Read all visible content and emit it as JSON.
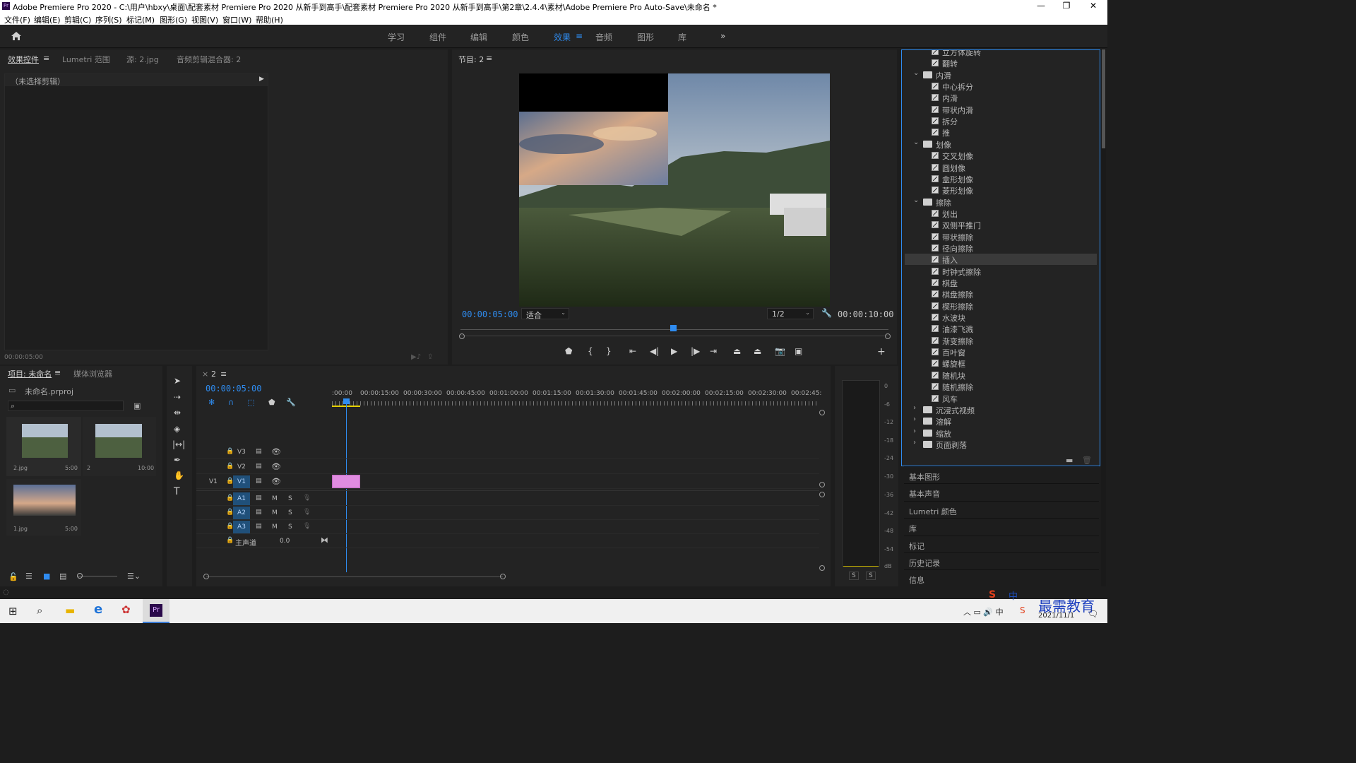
{
  "app": {
    "title": "Adobe Premiere Pro 2020 - C:\\用户\\hbxy\\桌面\\配套素材 Premiere Pro 2020 从新手到高手\\配套素材 Premiere Pro 2020 从新手到高手\\第2章\\2.4.4\\素材\\Adobe Premiere Pro Auto-Save\\未命名 *",
    "logo": "Pr"
  },
  "menu": [
    "文件(F)",
    "编辑(E)",
    "剪辑(C)",
    "序列(S)",
    "标记(M)",
    "图形(G)",
    "视图(V)",
    "窗口(W)",
    "帮助(H)"
  ],
  "workspaces": [
    "学习",
    "组件",
    "编辑",
    "颜色",
    "效果",
    "音频",
    "图形",
    "库"
  ],
  "active_workspace": "效果",
  "source_panel": {
    "tabs": [
      "效果控件",
      "Lumetri 范围",
      "源: 2.jpg",
      "音频剪辑混合器: 2"
    ],
    "no_clip": "（未选择剪辑）",
    "timecode": "00:00:05:00"
  },
  "program": {
    "title": "节目: 2",
    "timecode": "00:00:05:00",
    "fit": "适合",
    "resolution": "1/2",
    "duration": "00:00:10:00"
  },
  "project": {
    "tabs": [
      "项目: 未命名",
      "媒体浏览器"
    ],
    "file": "未命名.prproj",
    "items": [
      {
        "name": "2.jpg",
        "dur": "5:00"
      },
      {
        "name": "2",
        "dur": "10:00"
      },
      {
        "name": "1.jpg",
        "dur": "5:00"
      }
    ]
  },
  "timeline": {
    "tab": "2",
    "timecode": "00:00:05:00",
    "ruler": [
      ":00:00",
      "00:00:15:00",
      "00:00:30:00",
      "00:00:45:00",
      "00:01:00:00",
      "00:01:15:00",
      "00:01:30:00",
      "00:01:45:00",
      "00:02:00:00",
      "00:02:15:00",
      "00:02:30:00",
      "00:02:45:"
    ],
    "video_tracks": [
      "V3",
      "V2",
      "V1"
    ],
    "audio_tracks": [
      "A1",
      "A2",
      "A3"
    ],
    "master": "主声道",
    "master_val": "0.0",
    "source_patch": "V1",
    "track_m": "M",
    "track_s": "S"
  },
  "meter": {
    "labels": [
      "0",
      "-6",
      "-12",
      "-18",
      "-24",
      "-30",
      "-36",
      "-42",
      "-48",
      "-54",
      "dB"
    ],
    "solo": [
      "S",
      "S"
    ]
  },
  "effects_tree": [
    {
      "t": "item",
      "label": "立方体旋转"
    },
    {
      "t": "item",
      "label": "翻转"
    },
    {
      "t": "folder",
      "label": "内滑"
    },
    {
      "t": "item",
      "label": "中心拆分"
    },
    {
      "t": "item",
      "label": "内滑"
    },
    {
      "t": "item",
      "label": "带状内滑"
    },
    {
      "t": "item",
      "label": "拆分"
    },
    {
      "t": "item",
      "label": "推"
    },
    {
      "t": "folder",
      "label": "划像"
    },
    {
      "t": "item",
      "label": "交叉划像"
    },
    {
      "t": "item",
      "label": "圆划像"
    },
    {
      "t": "item",
      "label": "盒形划像"
    },
    {
      "t": "item",
      "label": "菱形划像"
    },
    {
      "t": "folder",
      "label": "擦除"
    },
    {
      "t": "item",
      "label": "划出"
    },
    {
      "t": "item",
      "label": "双侧平推门"
    },
    {
      "t": "item",
      "label": "带状擦除"
    },
    {
      "t": "item",
      "label": "径向擦除"
    },
    {
      "t": "item",
      "label": "插入",
      "selected": true
    },
    {
      "t": "item",
      "label": "时钟式擦除"
    },
    {
      "t": "item",
      "label": "棋盘"
    },
    {
      "t": "item",
      "label": "棋盘擦除"
    },
    {
      "t": "item",
      "label": "楔形擦除"
    },
    {
      "t": "item",
      "label": "水波块"
    },
    {
      "t": "item",
      "label": "油漆飞溅"
    },
    {
      "t": "item",
      "label": "渐变擦除"
    },
    {
      "t": "item",
      "label": "百叶窗"
    },
    {
      "t": "item",
      "label": "螺旋框"
    },
    {
      "t": "item",
      "label": "随机块"
    },
    {
      "t": "item",
      "label": "随机擦除"
    },
    {
      "t": "item",
      "label": "风车"
    },
    {
      "t": "cfolder",
      "label": "沉浸式视频"
    },
    {
      "t": "cfolder",
      "label": "溶解"
    },
    {
      "t": "cfolder",
      "label": "缩放"
    },
    {
      "t": "cfolder",
      "label": "页面剥落"
    }
  ],
  "right_panels": [
    "基本图形",
    "基本声音",
    "Lumetri 颜色",
    "库",
    "标记",
    "历史记录",
    "信息"
  ],
  "taskbar": {
    "date": "2021/11/1",
    "watermark": "最需教育",
    "ime": "中"
  },
  "colors": {
    "accent": "#2f8cf0",
    "clip": "#e08ce0",
    "playhead": "#2f8cf0"
  }
}
